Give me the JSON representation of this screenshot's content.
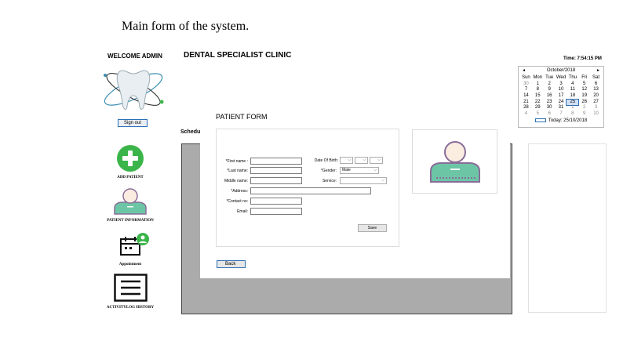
{
  "caption": "Main form of the system.",
  "sidebar": {
    "welcome": "WELCOME ADMIN",
    "signout_label": "Sign out",
    "items": [
      {
        "label": "ADD PATIENT",
        "icon": "plus-circle-icon"
      },
      {
        "label": "PATIENT INFORMATION",
        "icon": "patient-icon"
      },
      {
        "label": "Appointment",
        "icon": "calendar-add-icon"
      },
      {
        "label": "ACTIVITYLOG HISTORY",
        "icon": "list-icon"
      }
    ]
  },
  "header": {
    "clinic_title": "DENTAL SPECIALIST CLINIC",
    "time": "Time:  7:54:15 PM"
  },
  "calendar": {
    "month": "October/2018",
    "weekdays": [
      "Sun",
      "Mon",
      "Tue",
      "Wed",
      "Thu",
      "Fri",
      "Sat"
    ],
    "days": [
      "30",
      "1",
      "2",
      "3",
      "4",
      "5",
      "6",
      "7",
      "8",
      "9",
      "10",
      "11",
      "12",
      "13",
      "14",
      "15",
      "16",
      "17",
      "18",
      "19",
      "20",
      "21",
      "22",
      "23",
      "24",
      "25",
      "26",
      "27",
      "28",
      "29",
      "30",
      "31",
      "1",
      "2",
      "3",
      "4",
      "5",
      "6",
      "7",
      "8",
      "9",
      "10"
    ],
    "dimmed_indices": [
      0,
      32,
      33,
      34,
      35,
      36,
      37,
      38,
      39,
      40,
      41
    ],
    "selected_index": 25,
    "today": "Today: 25/10/2018"
  },
  "schedule_label": "Schedu",
  "patient_form": {
    "title": "PATIENT FORM",
    "labels": {
      "first_name": "*First name :",
      "last_name": "*Last name:",
      "middle_name": "Middle name:",
      "address": "*Address:",
      "contact": "*Contact no:",
      "email": "Email:",
      "dob": "Date Of Birth:",
      "gender": "*Gender:",
      "service": "Service:"
    },
    "gender_value": "Male",
    "save_label": "Save",
    "back_label": "Back"
  },
  "colors": {
    "accent_green": "#3bb54a",
    "patient_body": "#6cc6a6",
    "patient_outline": "#8a6c9a",
    "button_border": "#2a6fb5"
  }
}
